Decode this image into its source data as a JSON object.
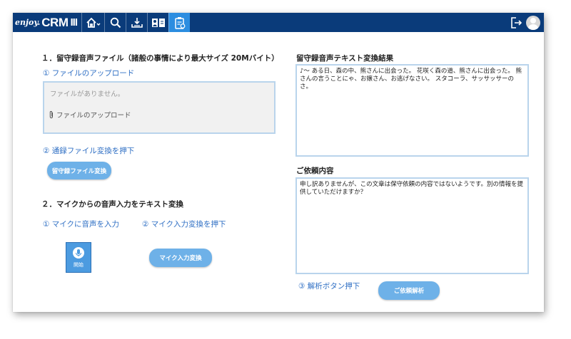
{
  "app": {
    "logo_enjoy": "enjoy.",
    "logo_crm": "CRM",
    "logo_version": "III"
  },
  "colors": {
    "topbar": "#0a3b7a",
    "active_tab": "#2c8de0",
    "button": "#6eb1e8",
    "step_text": "#2f6fc4",
    "border": "#b9d4ec"
  },
  "nav": [
    "home-icon",
    "search-icon",
    "download-icon",
    "book-icon",
    "clipboard-icon"
  ],
  "left": {
    "section1_heading": "１．留守録音声ファイル（諸般の事情により最大サイズ 20Mバイト）",
    "step1": "① ファイルのアップロード",
    "no_file": "ファイルがありません。",
    "upload_label": "ファイルのアップロード",
    "step2": "② 通録ファイル変換を押下",
    "convert_button": "留守録ファイル変換",
    "section2_heading": "２．マイクからの音声入力をテキスト変換",
    "mic_step1": "① マイクに音声を入力",
    "mic_step2": "② マイク入力変換を押下",
    "mic_start": "開始",
    "mic_convert_button": "マイク入力変換"
  },
  "right": {
    "result_heading": "留守録音声テキスト変換結果",
    "result_text": "♪～ ある日、森の中、熊さんに出会った。 花咲く森の道、熊さんに出会った。 熊さんの言うことにゃ、お嬢さん、お逃げなさい。 スタコーラ、サッサッサーのさ。",
    "request_heading": "ご依頼内容",
    "request_text": "申し訳ありませんが、この文章は保守依頼の内容ではないようです。別の情報を提供していただけますか？",
    "step3": "③ 解析ボタン押下",
    "analyze_button": "ご依頼解析"
  }
}
